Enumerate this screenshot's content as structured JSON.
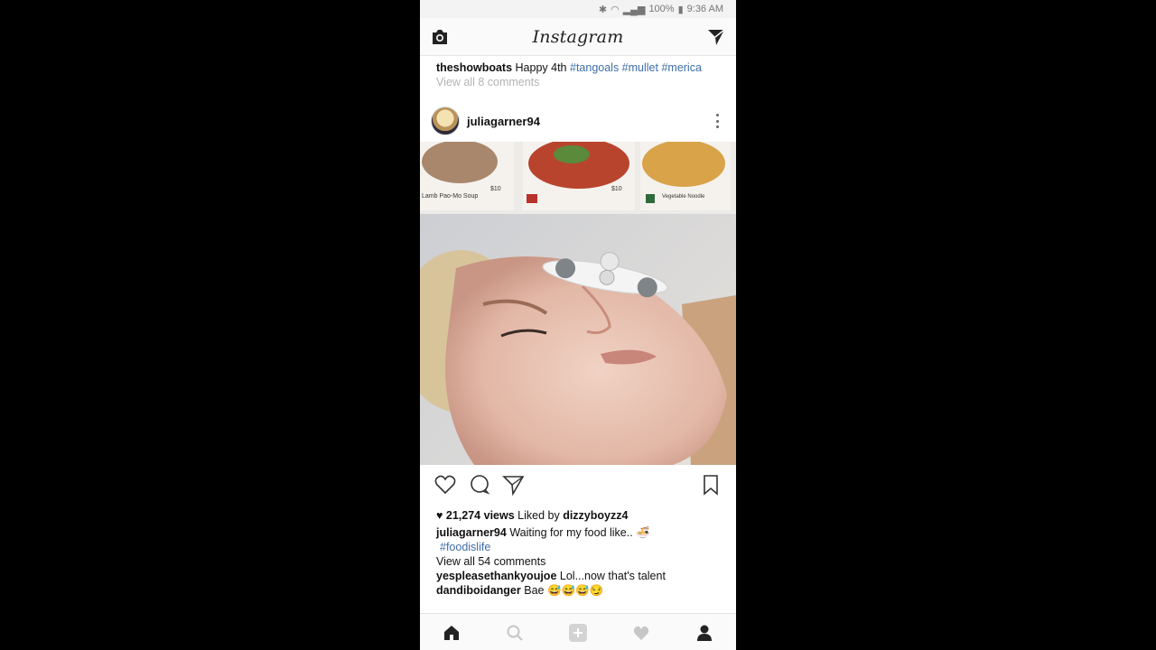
{
  "status_bar": {
    "battery": "100%",
    "time": "9:36 AM"
  },
  "header": {
    "logo": "Instagram",
    "camera_icon": "camera-icon",
    "direct_icon": "paper-plane-icon"
  },
  "previous_post": {
    "username": "theshowboats",
    "caption": "Happy 4th",
    "hashtags": "#tangoals #mullet #merica",
    "comments_link": "View all 8 comments"
  },
  "post": {
    "username": "juliagarner94",
    "views": "21,274 views",
    "liked_by_prefix": "Liked by",
    "liked_by_user": "dizzyboyzz4",
    "caption_user": "juliagarner94",
    "caption_text": "Waiting for my food like..",
    "caption_emoji": "🍜",
    "hashtag": "#foodislife",
    "comments_link": "View all 54 comments",
    "comments": [
      {
        "user": "yespleasethankyoujoe",
        "text": "Lol...now that's talent"
      },
      {
        "user": "dandiboidanger",
        "text": "Bae 😅😅😅😏"
      }
    ],
    "menu_labels": [
      "Lamb Pao-Mo Soup",
      "$10",
      "$10",
      "Vegetable Noodle"
    ]
  },
  "bottom_nav": {
    "items": [
      "home-icon",
      "search-icon",
      "add-icon",
      "heart-icon",
      "profile-icon"
    ]
  }
}
